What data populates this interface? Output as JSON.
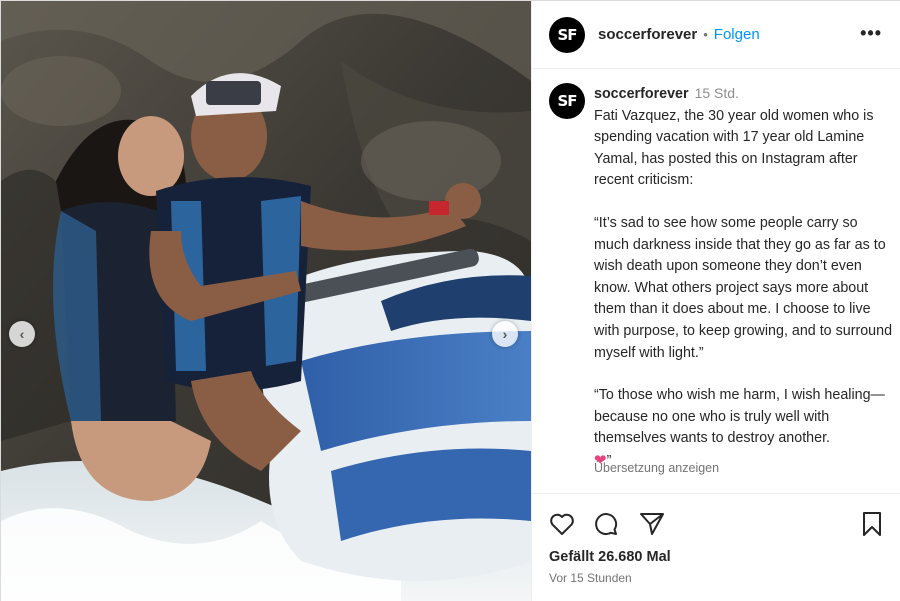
{
  "post": {
    "username": "soccerforever",
    "avatar_text": "SF",
    "follow_separator": "•",
    "follow_label": "Folgen",
    "more_icon": "•••",
    "caption": {
      "username": "soccerforever",
      "time": "15 Std.",
      "para1": "Fati Vazquez, the 30 year old women who is spending vacation with 17 year old Lamine Yamal, has posted this on Instagram after recent criticism:",
      "para2": "“It’s sad to see how some people carry so much darkness inside that they go as far as to wish death upon someone they don’t even know. What others project says more about them than it does about me. I choose to live with purpose, to keep growing, and to surround myself with light.”",
      "para3": "“To those who wish me harm, I wish healing—because no one who is truly well with themselves wants to destroy another.",
      "para3_end": "”",
      "heart_emoji": "❤"
    },
    "translate_label": "Übersetzung anzeigen",
    "likes_label": "Gefällt 26.680 Mal",
    "posted_label": "Vor 15 Stunden",
    "carousel": {
      "prev": "‹",
      "next": "›"
    }
  }
}
